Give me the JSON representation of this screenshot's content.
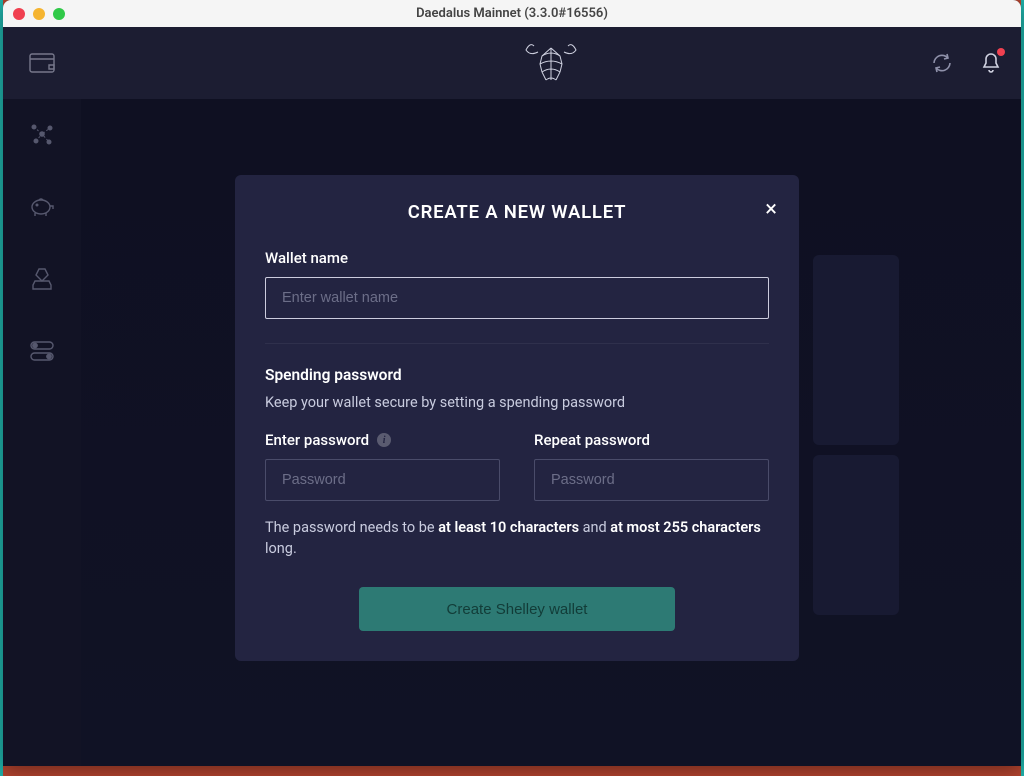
{
  "titlebar": "Daedalus Mainnet (3.3.0#16556)",
  "sidebar": {
    "items": [
      "wallet",
      "delegation",
      "staking",
      "voting",
      "settings"
    ]
  },
  "header": {
    "sync_icon": "sync-icon",
    "notifications_icon": "bell-icon",
    "has_notification": true
  },
  "modal": {
    "title": "CREATE A NEW WALLET",
    "close": "×",
    "wallet_name_label": "Wallet name",
    "wallet_name_placeholder": "Enter wallet name",
    "wallet_name_value": "",
    "spending_title": "Spending password",
    "spending_sub": "Keep your wallet secure by setting a spending password",
    "enter_password_label": "Enter password",
    "enter_password_placeholder": "Password",
    "enter_password_value": "",
    "repeat_password_label": "Repeat password",
    "repeat_password_placeholder": "Password",
    "repeat_password_value": "",
    "hint_pre": "The password needs to be ",
    "hint_b1": "at least 10 characters",
    "hint_mid": " and ",
    "hint_b2": "at most 255 characters",
    "hint_post": " long.",
    "submit_label": "Create Shelley wallet"
  }
}
